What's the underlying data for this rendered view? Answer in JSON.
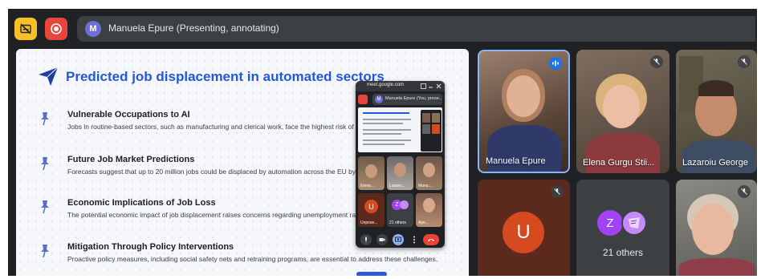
{
  "top_bar": {
    "presenter_initial": "M",
    "presenter_label": "Manuela Epure (Presenting, annotating)"
  },
  "slide": {
    "title": "Predicted job displacement in automated sectors",
    "bullets": [
      {
        "title": "Vulnerable Occupations to AI",
        "description": "Jobs in routine-based sectors, such as manufacturing and clerical work, face the highest risk of displacen"
      },
      {
        "title": "Future Job Market Predictions",
        "description": "Forecasts suggest that up to 20 million jobs could be displaced by automation across the EU by 2030."
      },
      {
        "title": "Economic Implications of Job Loss",
        "description": "The potential economic impact of job displacement raises concerns regarding unemployment rates and s"
      },
      {
        "title": "Mitigation Through Policy Interventions",
        "description": "Proactive policy measures, including social safety nets and retraining programs, are essential to address these challenges."
      }
    ]
  },
  "mini_window": {
    "url": "meet.google.com",
    "presenter_initial": "M",
    "presenter_label": "Manuela Epure (You, prese...",
    "tiles": [
      {
        "label": "Elena..."
      },
      {
        "label": "Lazaro..."
      },
      {
        "label": "Manu..."
      },
      {
        "initial": "U",
        "label": "Unpose..."
      },
      {
        "initial": "Z",
        "label": "21 others"
      },
      {
        "label": "Ape..."
      }
    ]
  },
  "participants": [
    {
      "name": "Manuela Epure",
      "state": "speaking"
    },
    {
      "name": "Elena Gurgu Stii...",
      "state": "muted"
    },
    {
      "name": "Lazaroiu George",
      "state": "muted"
    },
    {
      "initial": "U",
      "state": "muted"
    },
    {
      "initial": "Z",
      "label": "21 others"
    },
    {
      "name": "",
      "state": "muted"
    }
  ],
  "colors": {
    "background": "#202124",
    "accent_blue": "#2358d8",
    "record_red": "#e8453c",
    "caption_yellow": "#f7c026",
    "avatar_u": "#d64a1f",
    "avatar_z": "#a142f4",
    "active_speaker_border": "#8ab4f8"
  },
  "icons": {
    "captions_off": "captions-off-icon",
    "record": "record-icon",
    "slide_logo": "paper-plane-icon",
    "bullet": "pushpin-icon",
    "mic_off": "mic-off-icon",
    "speaking": "audio-wave-icon"
  }
}
